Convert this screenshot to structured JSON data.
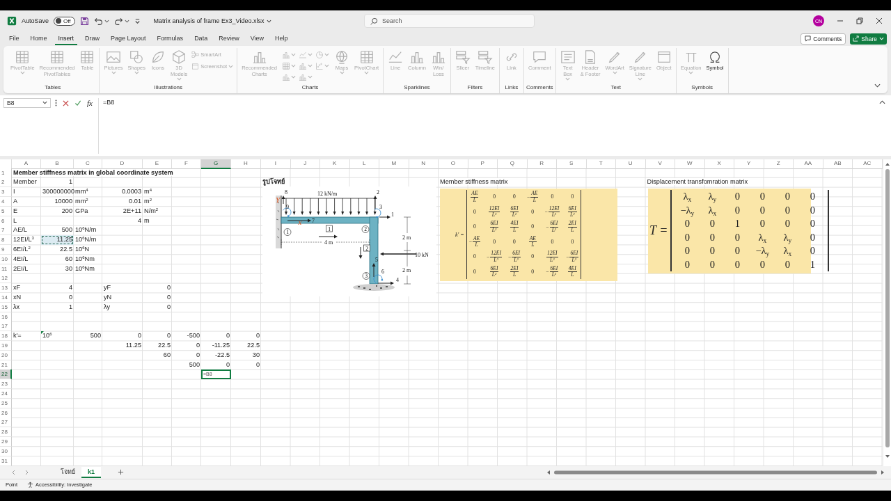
{
  "titlebar": {
    "autosave": {
      "label": "AutoSave",
      "state": "Off",
      "on": false
    },
    "title": "Matrix analysis of frame Ex3_Video.xlsx",
    "search": {
      "placeholder": "Search"
    },
    "avatar": "CN"
  },
  "menu": {
    "tabs": [
      {
        "label": "File",
        "selected": false
      },
      {
        "label": "Home",
        "selected": false
      },
      {
        "label": "Insert",
        "selected": true
      },
      {
        "label": "Draw",
        "selected": false
      },
      {
        "label": "Page Layout",
        "selected": false
      },
      {
        "label": "Formulas",
        "selected": false
      },
      {
        "label": "Data",
        "selected": false
      },
      {
        "label": "Review",
        "selected": false
      },
      {
        "label": "View",
        "selected": false
      },
      {
        "label": "Help",
        "selected": false
      }
    ],
    "comments": "Comments",
    "share": "Share"
  },
  "ribbon": {
    "groups": [
      {
        "label": "Tables",
        "items": [
          {
            "label": "PivotTable",
            "kind": "large",
            "disabled": true,
            "dropdown": true
          },
          {
            "label": "Recommended\nPivotTables",
            "kind": "large",
            "disabled": true,
            "dropdown": false
          },
          {
            "label": "Table",
            "kind": "large",
            "disabled": true,
            "dropdown": false
          }
        ]
      },
      {
        "label": "Illustrations",
        "items": [
          {
            "label": "Pictures",
            "kind": "large",
            "disabled": true,
            "dropdown": true
          },
          {
            "label": "Shapes",
            "kind": "large",
            "disabled": true,
            "dropdown": true
          },
          {
            "label": "Icons",
            "kind": "large",
            "disabled": true,
            "dropdown": false
          },
          {
            "label": "3D\nModels",
            "kind": "large",
            "disabled": true,
            "dropdown": true
          },
          {
            "label": "SmartArt",
            "kind": "small",
            "disabled": true,
            "dropdown": false
          },
          {
            "label": "Screenshot",
            "kind": "small",
            "disabled": true,
            "dropdown": true
          }
        ]
      },
      {
        "label": "Charts",
        "items": [
          {
            "label": "Recommended\nCharts",
            "kind": "large",
            "disabled": true,
            "dropdown": false
          },
          {
            "kind": "icon",
            "disabled": true,
            "dropdown": true
          },
          {
            "kind": "icon",
            "disabled": true,
            "dropdown": true
          },
          {
            "kind": "icon",
            "disabled": true,
            "dropdown": true
          },
          {
            "kind": "icon",
            "disabled": true,
            "dropdown": true
          },
          {
            "kind": "icon",
            "disabled": true,
            "dropdown": true
          },
          {
            "kind": "icon",
            "disabled": true,
            "dropdown": true
          },
          {
            "kind": "icon",
            "disabled": true,
            "dropdown": true
          },
          {
            "kind": "icon",
            "disabled": true,
            "dropdown": true
          },
          {
            "label": "Maps",
            "kind": "large",
            "disabled": true,
            "dropdown": true
          },
          {
            "label": "PivotChart",
            "kind": "large",
            "disabled": true,
            "dropdown": true
          }
        ]
      },
      {
        "label": "Sparklines",
        "items": [
          {
            "label": "Line",
            "kind": "large",
            "disabled": true,
            "dropdown": false
          },
          {
            "label": "Column",
            "kind": "large",
            "disabled": true,
            "dropdown": false
          },
          {
            "label": "Win/\nLoss",
            "kind": "large",
            "disabled": true,
            "dropdown": false
          }
        ]
      },
      {
        "label": "Filters",
        "items": [
          {
            "label": "Slicer",
            "kind": "large",
            "disabled": true,
            "dropdown": false
          },
          {
            "label": "Timeline",
            "kind": "large",
            "disabled": true,
            "dropdown": false
          }
        ]
      },
      {
        "label": "Links",
        "items": [
          {
            "label": "Link",
            "kind": "large",
            "disabled": true,
            "dropdown": false
          }
        ]
      },
      {
        "label": "Comments",
        "items": [
          {
            "label": "Comment",
            "kind": "large",
            "disabled": true,
            "dropdown": false
          }
        ]
      },
      {
        "label": "Text",
        "items": [
          {
            "label": "Text\nBox",
            "kind": "large",
            "disabled": true,
            "dropdown": true
          },
          {
            "label": "Header\n& Footer",
            "kind": "large",
            "disabled": true,
            "dropdown": false
          },
          {
            "label": "WordArt",
            "kind": "large",
            "disabled": true,
            "dropdown": true
          },
          {
            "label": "Signature\nLine",
            "kind": "large",
            "disabled": true,
            "dropdown": true
          },
          {
            "label": "Object",
            "kind": "large",
            "disabled": true,
            "dropdown": false
          }
        ]
      },
      {
        "label": "Symbols",
        "items": [
          {
            "label": "Equation",
            "kind": "large",
            "disabled": true,
            "dropdown": true
          },
          {
            "label": "Symbol",
            "kind": "large",
            "disabled": false,
            "dropdown": false
          }
        ]
      }
    ]
  },
  "formula_bar": {
    "name_box": "B8",
    "function_button": "fx",
    "formula": "=B8"
  },
  "sheet": {
    "columns": [
      {
        "label": "A",
        "selected": false
      },
      {
        "label": "B",
        "selected": false
      },
      {
        "label": "C",
        "selected": false
      },
      {
        "label": "D",
        "selected": false
      },
      {
        "label": "E",
        "selected": false
      },
      {
        "label": "F",
        "selected": false
      },
      {
        "label": "G",
        "selected": true
      },
      {
        "label": "H",
        "selected": false
      },
      {
        "label": "I",
        "selected": false
      },
      {
        "label": "J",
        "selected": false
      },
      {
        "label": "K",
        "selected": false
      },
      {
        "label": "L",
        "selected": false
      },
      {
        "label": "M",
        "selected": false
      },
      {
        "label": "N",
        "selected": false
      },
      {
        "label": "O",
        "selected": false
      },
      {
        "label": "P",
        "selected": false
      },
      {
        "label": "Q",
        "selected": false
      },
      {
        "label": "R",
        "selected": false
      },
      {
        "label": "S",
        "selected": false
      },
      {
        "label": "T",
        "selected": false
      },
      {
        "label": "U",
        "selected": false
      },
      {
        "label": "V",
        "selected": false
      },
      {
        "label": "W",
        "selected": false
      },
      {
        "label": "X",
        "selected": false
      },
      {
        "label": "Y",
        "selected": false
      },
      {
        "label": "Z",
        "selected": false
      },
      {
        "label": "AA",
        "selected": false
      },
      {
        "label": "AB",
        "selected": false
      },
      {
        "label": "AC",
        "selected": false
      }
    ],
    "rows": [
      {
        "header": "1",
        "selected": false,
        "cells": [
          {
            "text": "Member stiffness matrix in global coordinate system",
            "kind": "heading",
            "selected": false,
            "referenced": false
          }
        ]
      },
      {
        "header": "2",
        "selected": false,
        "cells": [
          {
            "text": "Member",
            "kind": "text",
            "selected": false,
            "referenced": false
          },
          {
            "text": "1",
            "kind": "number",
            "selected": false,
            "referenced": false
          },
          "",
          "",
          "",
          "",
          "",
          "",
          {
            "text": "รูปโจทย์",
            "kind": "heading",
            "selected": false,
            "referenced": false
          },
          "",
          "",
          "",
          "",
          "",
          {
            "text": "Member stiffness matrix",
            "kind": "text",
            "selected": false,
            "referenced": false
          },
          "",
          "",
          "",
          "",
          "",
          "",
          {
            "text": "Displacement transfomration matrix",
            "kind": "text",
            "selected": false,
            "referenced": false
          }
        ]
      },
      {
        "header": "3",
        "selected": false,
        "cells": [
          {
            "text": "I",
            "kind": "text",
            "selected": false,
            "referenced": false
          },
          {
            "text": "300000000",
            "kind": "number",
            "selected": false,
            "referenced": false
          },
          {
            "text": "mm$^{4}$",
            "kind": "text",
            "selected": false,
            "referenced": false
          },
          {
            "text": "0.0003",
            "kind": "number",
            "selected": false,
            "referenced": false
          },
          {
            "text": "m$^{4}$",
            "kind": "text",
            "selected": false,
            "referenced": false
          }
        ]
      },
      {
        "header": "4",
        "selected": false,
        "cells": [
          {
            "text": "A",
            "kind": "text",
            "selected": false,
            "referenced": false
          },
          {
            "text": "10000",
            "kind": "number",
            "selected": false,
            "referenced": false
          },
          {
            "text": "mm$^{2}$",
            "kind": "text",
            "selected": false,
            "referenced": false
          },
          {
            "text": "0.01",
            "kind": "number",
            "selected": false,
            "referenced": false
          },
          {
            "text": "m$^{2}$",
            "kind": "text",
            "selected": false,
            "referenced": false
          }
        ]
      },
      {
        "header": "5",
        "selected": false,
        "cells": [
          {
            "text": "E",
            "kind": "text",
            "selected": false,
            "referenced": false
          },
          {
            "text": "200",
            "kind": "number",
            "selected": false,
            "referenced": false
          },
          {
            "text": "GPa",
            "kind": "text",
            "selected": false,
            "referenced": false
          },
          {
            "text": "2E+11",
            "kind": "number",
            "selected": false,
            "referenced": false
          },
          {
            "text": "N/m$^{2}$",
            "kind": "text",
            "selected": false,
            "referenced": false
          }
        ]
      },
      {
        "header": "6",
        "selected": false,
        "cells": [
          {
            "text": "L",
            "kind": "text",
            "selected": false,
            "referenced": false
          },
          "",
          "",
          {
            "text": "4",
            "kind": "number",
            "selected": false,
            "referenced": false
          },
          {
            "text": "m",
            "kind": "text",
            "selected": false,
            "referenced": false
          }
        ]
      },
      {
        "header": "7",
        "selected": false,
        "cells": [
          {
            "text": "AE/L",
            "kind": "text",
            "selected": false,
            "referenced": false
          },
          {
            "text": "500",
            "kind": "number",
            "selected": false,
            "referenced": false
          },
          {
            "text": "10$^{6}$N/m",
            "kind": "text",
            "selected": false,
            "referenced": false
          }
        ]
      },
      {
        "header": "8",
        "selected": false,
        "cells": [
          {
            "text": "12EI/L$^{3}$",
            "kind": "text",
            "selected": false,
            "referenced": false
          },
          {
            "text": "11.25",
            "kind": "number",
            "selected": false,
            "referenced": true
          },
          {
            "text": "10$^{6}$N/m",
            "kind": "text",
            "selected": false,
            "referenced": false
          }
        ]
      },
      {
        "header": "9",
        "selected": false,
        "cells": [
          {
            "text": "6EI/L$^{2}$",
            "kind": "text",
            "selected": false,
            "referenced": false
          },
          {
            "text": "22.5",
            "kind": "number",
            "selected": false,
            "referenced": false
          },
          {
            "text": "10$^{6}$N",
            "kind": "text",
            "selected": false,
            "referenced": false
          }
        ]
      },
      {
        "header": "10",
        "selected": false,
        "cells": [
          {
            "text": "4EI/L",
            "kind": "text",
            "selected": false,
            "referenced": false
          },
          {
            "text": "60",
            "kind": "number",
            "selected": false,
            "referenced": false
          },
          {
            "text": "10$^{6}$Nm",
            "kind": "text",
            "selected": false,
            "referenced": false
          }
        ]
      },
      {
        "header": "11",
        "selected": false,
        "cells": [
          {
            "text": "2EI/L",
            "kind": "text",
            "selected": false,
            "referenced": false
          },
          {
            "text": "30",
            "kind": "number",
            "selected": false,
            "referenced": false
          },
          {
            "text": "10$^{6}$Nm",
            "kind": "text",
            "selected": false,
            "referenced": false
          }
        ]
      },
      {
        "header": "12",
        "selected": false
      },
      {
        "header": "13",
        "selected": false,
        "cells": [
          {
            "text": "xF",
            "kind": "text",
            "selected": false,
            "referenced": false
          },
          {
            "text": "4",
            "kind": "number",
            "selected": false,
            "referenced": false
          },
          "",
          {
            "text": "yF",
            "kind": "text",
            "selected": false,
            "referenced": false
          },
          {
            "text": "0",
            "kind": "number",
            "selected": false,
            "referenced": false
          }
        ]
      },
      {
        "header": "14",
        "selected": false,
        "cells": [
          {
            "text": "xN",
            "kind": "text",
            "selected": false,
            "referenced": false
          },
          {
            "text": "0",
            "kind": "number",
            "selected": false,
            "referenced": false
          },
          "",
          {
            "text": "yN",
            "kind": "text",
            "selected": false,
            "referenced": false
          },
          {
            "text": "0",
            "kind": "number",
            "selected": false,
            "referenced": false
          }
        ]
      },
      {
        "header": "15",
        "selected": false,
        "cells": [
          {
            "text": "λx",
            "kind": "text",
            "selected": false,
            "referenced": false
          },
          {
            "text": "1",
            "kind": "number",
            "selected": false,
            "referenced": false
          },
          "",
          {
            "text": "λy",
            "kind": "text",
            "selected": false,
            "referenced": false
          },
          {
            "text": "0",
            "kind": "number",
            "selected": false,
            "referenced": false
          }
        ]
      },
      {
        "header": "16",
        "selected": false
      },
      {
        "header": "17",
        "selected": false
      },
      {
        "header": "18",
        "selected": false,
        "cells": [
          {
            "text": "k'=",
            "kind": "text",
            "selected": false,
            "referenced": false
          },
          {
            "text": "10$^{6}$",
            "kind": "flagged",
            "selected": false,
            "referenced": false
          },
          {
            "text": "500",
            "kind": "number",
            "selected": false,
            "referenced": false
          },
          {
            "text": "0",
            "kind": "number",
            "selected": false,
            "referenced": false
          },
          {
            "text": "0",
            "kind": "number",
            "selected": false,
            "referenced": false
          },
          {
            "text": "-500",
            "kind": "number",
            "selected": false,
            "referenced": false
          },
          {
            "text": "0",
            "kind": "number",
            "selected": false,
            "referenced": false
          },
          {
            "text": "0",
            "kind": "number",
            "selected": false,
            "referenced": false
          }
        ]
      },
      {
        "header": "19",
        "selected": false,
        "cells": [
          "",
          "",
          "",
          {
            "text": "11.25",
            "kind": "number",
            "selected": false,
            "referenced": false
          },
          {
            "text": "22.5",
            "kind": "number",
            "selected": false,
            "referenced": false
          },
          {
            "text": "0",
            "kind": "number",
            "selected": false,
            "referenced": false
          },
          {
            "text": "-11.25",
            "kind": "number",
            "selected": false,
            "referenced": false
          },
          {
            "text": "22.5",
            "kind": "number",
            "selected": false,
            "referenced": false
          }
        ]
      },
      {
        "header": "20",
        "selected": false,
        "cells": [
          "",
          "",
          "",
          "",
          {
            "text": "60",
            "kind": "number",
            "selected": false,
            "referenced": false
          },
          {
            "text": "0",
            "kind": "number",
            "selected": false,
            "referenced": false
          },
          {
            "text": "-22.5",
            "kind": "number",
            "selected": false,
            "referenced": false
          },
          {
            "text": "30",
            "kind": "number",
            "selected": false,
            "referenced": false
          }
        ]
      },
      {
        "header": "21",
        "selected": false,
        "cells": [
          "",
          "",
          "",
          "",
          "",
          {
            "text": "500",
            "kind": "number",
            "selected": false,
            "referenced": false
          },
          {
            "text": "0",
            "kind": "number",
            "selected": false,
            "referenced": false
          },
          {
            "text": "0",
            "kind": "number",
            "selected": false,
            "referenced": false
          }
        ]
      },
      {
        "header": "22",
        "selected": true,
        "cells": [
          "",
          "",
          "",
          "",
          "",
          "",
          {
            "text": "=B8",
            "kind": "text",
            "selected": true,
            "referenced": false
          }
        ]
      },
      {
        "header": "23",
        "selected": false
      },
      {
        "header": "24",
        "selected": false
      },
      {
        "header": "25",
        "selected": false
      },
      {
        "header": "26",
        "selected": false
      },
      {
        "header": "27",
        "selected": false
      },
      {
        "header": "28",
        "selected": false
      },
      {
        "header": "29",
        "selected": false
      },
      {
        "header": "30",
        "selected": false
      },
      {
        "header": "31",
        "selected": false
      }
    ],
    "figure": {
      "labels": [
        {
          "text": "8",
          "kind": "dof"
        },
        {
          "text": "9",
          "kind": "dof"
        },
        {
          "text": "12 kN/m",
          "kind": "load"
        },
        {
          "text": "2",
          "kind": "dof"
        },
        {
          "text": "3",
          "kind": "dof"
        },
        {
          "text": "7",
          "kind": "dof"
        },
        {
          "text": "1",
          "kind": "dof"
        },
        {
          "text": "1",
          "kind": "node"
        },
        {
          "text": "1",
          "kind": "member"
        },
        {
          "text": "2",
          "kind": "node"
        },
        {
          "text": "4 m",
          "kind": "dimension"
        },
        {
          "text": "2 m",
          "kind": "dimension"
        },
        {
          "text": "2",
          "kind": "member"
        },
        {
          "text": "10 kN",
          "kind": "load"
        },
        {
          "text": "2 m",
          "kind": "dimension"
        },
        {
          "text": "5",
          "kind": "dof"
        },
        {
          "text": "6",
          "kind": "dof"
        },
        {
          "text": "3",
          "kind": "node"
        },
        {
          "text": "4",
          "kind": "dof"
        },
        {
          "text": "Y",
          "kind": "annotation"
        },
        {
          "text": "x",
          "kind": "annotation"
        }
      ]
    },
    "stiffness_matrix": {
      "symbol": "k′ =",
      "rows": [
        [
          {
            "num": "AE",
            "den": "L"
          },
          {
            "value": "0"
          },
          {
            "value": "0"
          },
          {
            "sign": "−",
            "num": "AE",
            "den": "L"
          },
          {
            "value": "0"
          },
          {
            "value": "0"
          }
        ],
        [
          {
            "value": "0"
          },
          {
            "num": "12EI",
            "den": "L$^{3}$"
          },
          {
            "num": "6EI",
            "den": "L$^{2}$"
          },
          {
            "value": "0"
          },
          {
            "sign": "−",
            "num": "12EI",
            "den": "L$^{3}$"
          },
          {
            "num": "6EI",
            "den": "L$^{2}$"
          }
        ],
        [
          {
            "value": "0"
          },
          {
            "num": "6EI",
            "den": "L$^{2}$"
          },
          {
            "num": "4EI",
            "den": "L"
          },
          {
            "value": "0"
          },
          {
            "sign": "−",
            "num": "6EI",
            "den": "L$^{2}$"
          },
          {
            "num": "2EI",
            "den": "L"
          }
        ],
        [
          {
            "sign": "−",
            "num": "AE",
            "den": "L"
          },
          {
            "value": "0"
          },
          {
            "value": "0"
          },
          {
            "num": "AE",
            "den": "L"
          },
          {
            "value": "0"
          },
          {
            "value": "0"
          }
        ],
        [
          {
            "value": "0"
          },
          {
            "sign": "−",
            "num": "12EI",
            "den": "L$^{3}$"
          },
          {
            "sign": "−",
            "num": "6EI",
            "den": "L$^{2}$"
          },
          {
            "value": "0"
          },
          {
            "num": "12EI",
            "den": "L$^{3}$"
          },
          {
            "sign": "−",
            "num": "6EI",
            "den": "L$^{2}$"
          }
        ],
        [
          {
            "value": "0"
          },
          {
            "num": "6EI",
            "den": "L$^{2}$"
          },
          {
            "num": "2EI",
            "den": "L"
          },
          {
            "value": "0"
          },
          {
            "sign": "−",
            "num": "6EI",
            "den": "L$^{2}$"
          },
          {
            "num": "4EI",
            "den": "L"
          }
        ]
      ]
    },
    "transformation_matrix": {
      "symbol": "T =",
      "rows": [
        [
          "λ$_{x}$",
          "λ$_{y}$",
          "0",
          "0",
          "0",
          "0"
        ],
        [
          "−λ$_{y}$",
          "λ$_{x}$",
          "0",
          "0",
          "0",
          "0"
        ],
        [
          "0",
          "0",
          "1",
          "0",
          "0",
          "0"
        ],
        [
          "0",
          "0",
          "0",
          "λ$_{x}$",
          "λ$_{y}$",
          "0"
        ],
        [
          "0",
          "0",
          "0",
          "−λ$_{y}$",
          "λ$_{x}$",
          "0"
        ],
        [
          "0",
          "0",
          "0",
          "0",
          "0",
          "1"
        ]
      ]
    }
  },
  "sheet_tabs": {
    "tabs": [
      {
        "label": "โจทย์",
        "selected": false
      },
      {
        "label": "k1",
        "selected": true
      }
    ]
  },
  "status_bar": {
    "mode": "Point",
    "accessibility": "Accessibility: Investigate"
  }
}
